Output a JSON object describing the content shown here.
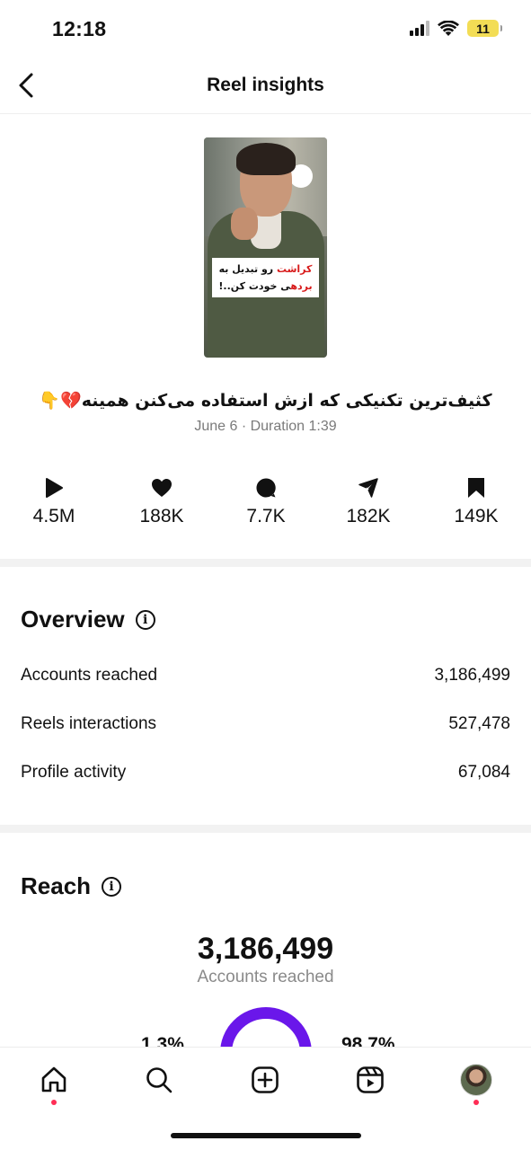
{
  "status_bar": {
    "time": "12:18",
    "battery": "11"
  },
  "header": {
    "title": "Reel insights"
  },
  "reel": {
    "thumbnail_text": {
      "red_word_1": "کراشت",
      "line1_rest": " رو تبدیل به",
      "red_word_2": "برده",
      "line2_rest": "ی خودت کن..!"
    },
    "caption": "کثیف‌ترین تکنیکی که ازش استفاده می‌کنن همینه",
    "caption_emojis": [
      "💔",
      "👇"
    ],
    "meta": "June 6 · Duration 1:39"
  },
  "stats": [
    {
      "icon": "play-icon",
      "value": "4.5M"
    },
    {
      "icon": "heart-icon",
      "value": "188K"
    },
    {
      "icon": "comment-icon",
      "value": "7.7K"
    },
    {
      "icon": "share-icon",
      "value": "182K"
    },
    {
      "icon": "save-icon",
      "value": "149K"
    }
  ],
  "overview": {
    "title": "Overview",
    "rows": [
      {
        "label": "Accounts reached",
        "value": "3,186,499"
      },
      {
        "label": "Reels interactions",
        "value": "527,478"
      },
      {
        "label": "Profile activity",
        "value": "67,084"
      }
    ]
  },
  "reach": {
    "title": "Reach",
    "total": "3,186,499",
    "label": "Accounts reached",
    "left_pct": "1.3%",
    "right_pct": "98.7%"
  },
  "tabbar": [
    "home-icon",
    "search-icon",
    "create-icon",
    "reels-icon",
    "profile-avatar"
  ],
  "colors": {
    "accent": "#6a17ea",
    "notification_dot": "#ff2d55",
    "thumbnail_highlight": "#d81b1b"
  }
}
